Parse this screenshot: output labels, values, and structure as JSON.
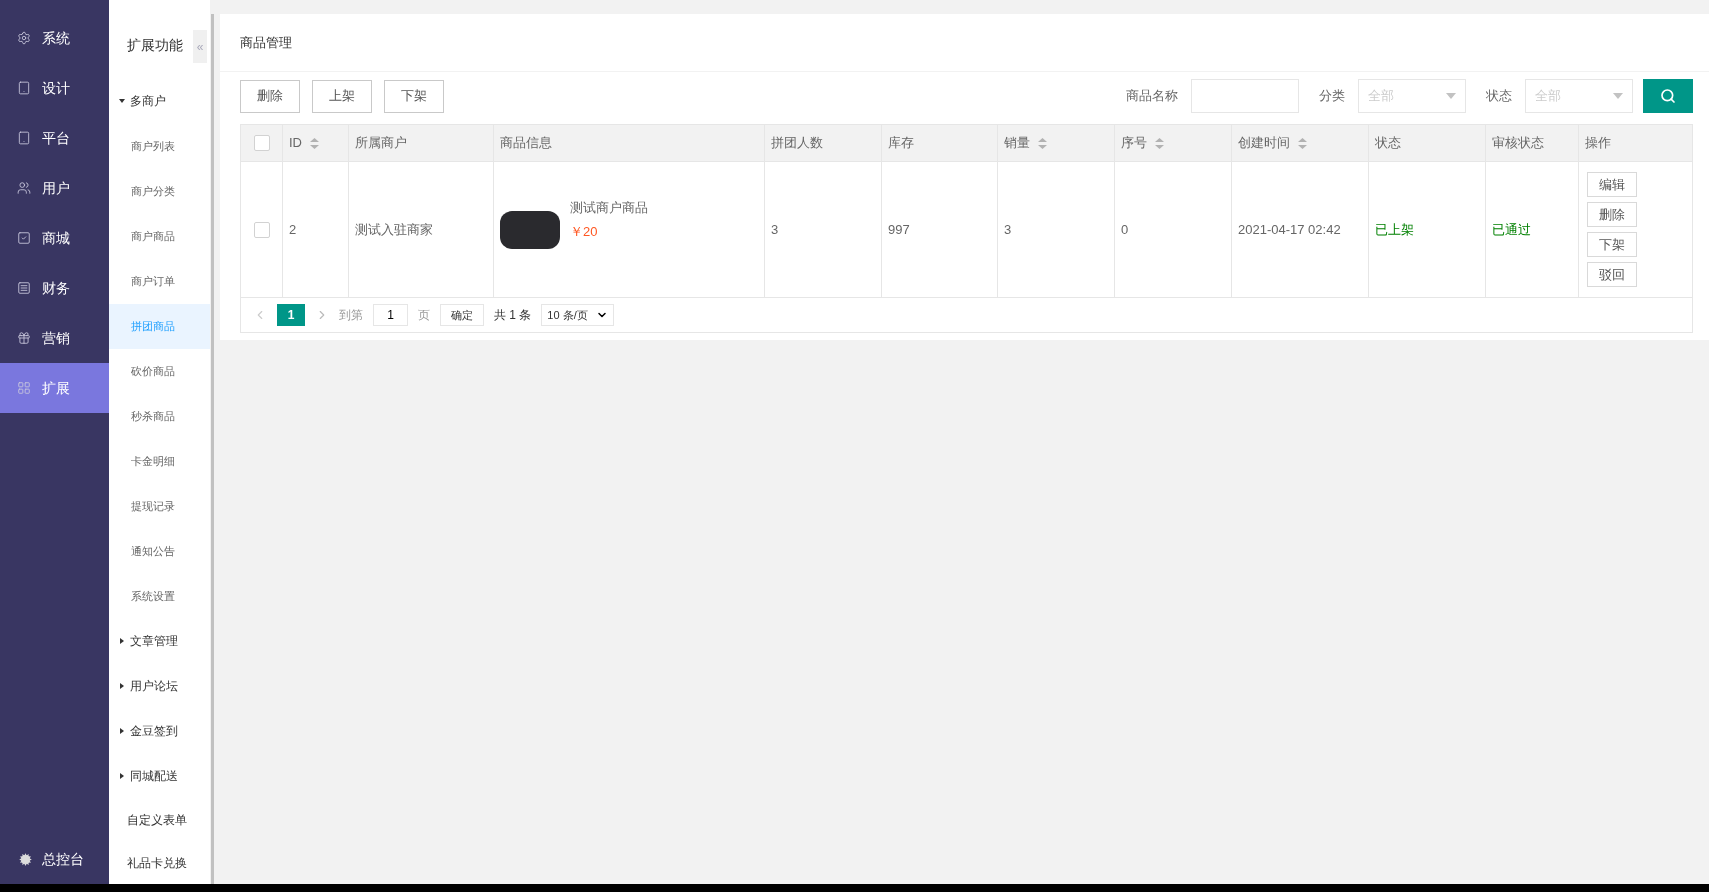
{
  "sidebar": {
    "items": [
      {
        "label": "系统",
        "selected": false
      },
      {
        "label": "设计",
        "selected": false
      },
      {
        "label": "平台",
        "selected": false
      },
      {
        "label": "用户",
        "selected": false
      },
      {
        "label": "商城",
        "selected": false
      },
      {
        "label": "财务",
        "selected": false
      },
      {
        "label": "营销",
        "selected": false
      },
      {
        "label": "扩展",
        "selected": true
      }
    ],
    "footer": {
      "label": "总控台"
    }
  },
  "submenu": {
    "title": "扩展功能",
    "collapse": "«",
    "items": [
      {
        "kind": "group",
        "label": "多商户",
        "expanded": true,
        "children": [
          {
            "label": "商户列表",
            "selected": false
          },
          {
            "label": "商户分类",
            "selected": false
          },
          {
            "label": "商户商品",
            "selected": false
          },
          {
            "label": "商户订单",
            "selected": false
          },
          {
            "label": "拼团商品",
            "selected": true
          },
          {
            "label": "砍价商品",
            "selected": false
          },
          {
            "label": "秒杀商品",
            "selected": false
          },
          {
            "label": "卡金明细",
            "selected": false
          },
          {
            "label": "提现记录",
            "selected": false
          },
          {
            "label": "通知公告",
            "selected": false
          },
          {
            "label": "系统设置",
            "selected": false
          }
        ]
      },
      {
        "kind": "group",
        "label": "文章管理",
        "expanded": false
      },
      {
        "kind": "group",
        "label": "用户论坛",
        "expanded": false
      },
      {
        "kind": "group",
        "label": "金豆签到",
        "expanded": false
      },
      {
        "kind": "group",
        "label": "同城配送",
        "expanded": false
      },
      {
        "kind": "link",
        "label": "自定义表单"
      },
      {
        "kind": "link",
        "label": "礼品卡兑换"
      }
    ]
  },
  "page": {
    "title": "商品管理"
  },
  "toolbar": {
    "buttons": [
      "删除",
      "上架",
      "下架"
    ],
    "filters": [
      {
        "kind": "text",
        "label": "商品名称"
      },
      {
        "kind": "select",
        "label": "分类",
        "placeholder": "全部"
      },
      {
        "kind": "select",
        "label": "状态",
        "placeholder": "全部"
      }
    ]
  },
  "table": {
    "header_checked": false,
    "columns": [
      {
        "label": "ID",
        "sortable": true
      },
      {
        "label": "所属商户",
        "sortable": false
      },
      {
        "label": "商品信息",
        "sortable": false
      },
      {
        "label": "拼团人数",
        "sortable": false
      },
      {
        "label": "库存",
        "sortable": false
      },
      {
        "label": "销量",
        "sortable": true
      },
      {
        "label": "序号",
        "sortable": true
      },
      {
        "label": "创建时间",
        "sortable": true
      },
      {
        "label": "状态",
        "sortable": false
      },
      {
        "label": "审核状态",
        "sortable": false
      },
      {
        "label": "操作",
        "sortable": false
      }
    ],
    "rows": [
      {
        "checked": false,
        "id": "2",
        "merchant": "测试入驻商家",
        "product": {
          "name": "测试商户商品",
          "price": "￥20"
        },
        "group_size": "3",
        "stock": "997",
        "sales": "3",
        "sort": "0",
        "created": "2021-04-17 02:42",
        "status": "已上架",
        "review": "已通过",
        "actions": [
          "编辑",
          "删除",
          "下架",
          "驳回"
        ]
      }
    ]
  },
  "pagination": {
    "pages": [
      {
        "label": "1",
        "selected": true
      }
    ],
    "goto_label": "到第",
    "goto_value": "1",
    "page_suffix": "页",
    "confirm": "确定",
    "total": "共 1 条",
    "page_size": "10 条/页"
  }
}
